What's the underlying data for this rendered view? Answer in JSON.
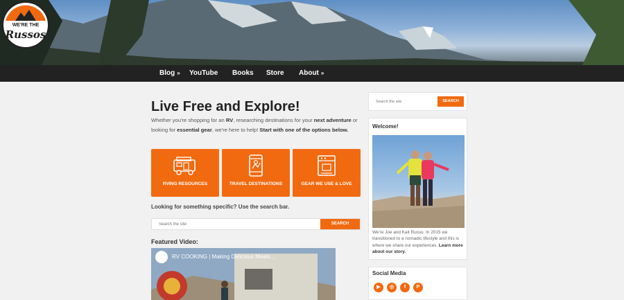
{
  "brand": {
    "logo_text": "WE'RE THE Russos",
    "accent": "#f26a10"
  },
  "nav": {
    "items": [
      {
        "label": "Blog",
        "has_submenu": true
      },
      {
        "label": "YouTube",
        "has_submenu": false
      },
      {
        "label": "Books",
        "has_submenu": false
      },
      {
        "label": "Store",
        "has_submenu": false
      },
      {
        "label": "About",
        "has_submenu": true
      }
    ],
    "submenu_glyph": "»"
  },
  "main": {
    "headline": "Live Free and Explore!",
    "intro": {
      "p1": "Whether you're shopping for an ",
      "b1": "RV",
      "p2": ", researching destinations for your ",
      "b2": "next adventure",
      "p3": " or looking for ",
      "b3": "essential gear",
      "p4": ", we're here to help! ",
      "b4": "Start with one of the options below."
    },
    "tiles": [
      {
        "label": "RVING RESOURCES",
        "icon": "rv-icon"
      },
      {
        "label": "TRAVEL DESTINATIONS",
        "icon": "phone-map-icon"
      },
      {
        "label": "GEAR WE USE & LOVE",
        "icon": "coffee-maker-icon"
      }
    ],
    "search_prompt": "Looking for something specific? Use the search bar.",
    "search": {
      "placeholder": "Search the site",
      "button": "SEARCH"
    },
    "featured_label": "Featured Video:",
    "video": {
      "title": "RV COOKING | Making Delicious Meals..."
    }
  },
  "sidebar": {
    "search": {
      "placeholder": "Search the site",
      "button": "SEARCH"
    },
    "welcome": {
      "title": "Welcome!",
      "text": "We're Joe and Kait Russo. In 2015 we transitioned to a nomadic lifestyle and this is where we share our experiences.",
      "link": "Learn more about our story."
    },
    "social": {
      "title": "Social Media",
      "icons": [
        "youtube-icon",
        "instagram-icon",
        "facebook-icon",
        "patreon-icon"
      ]
    }
  }
}
